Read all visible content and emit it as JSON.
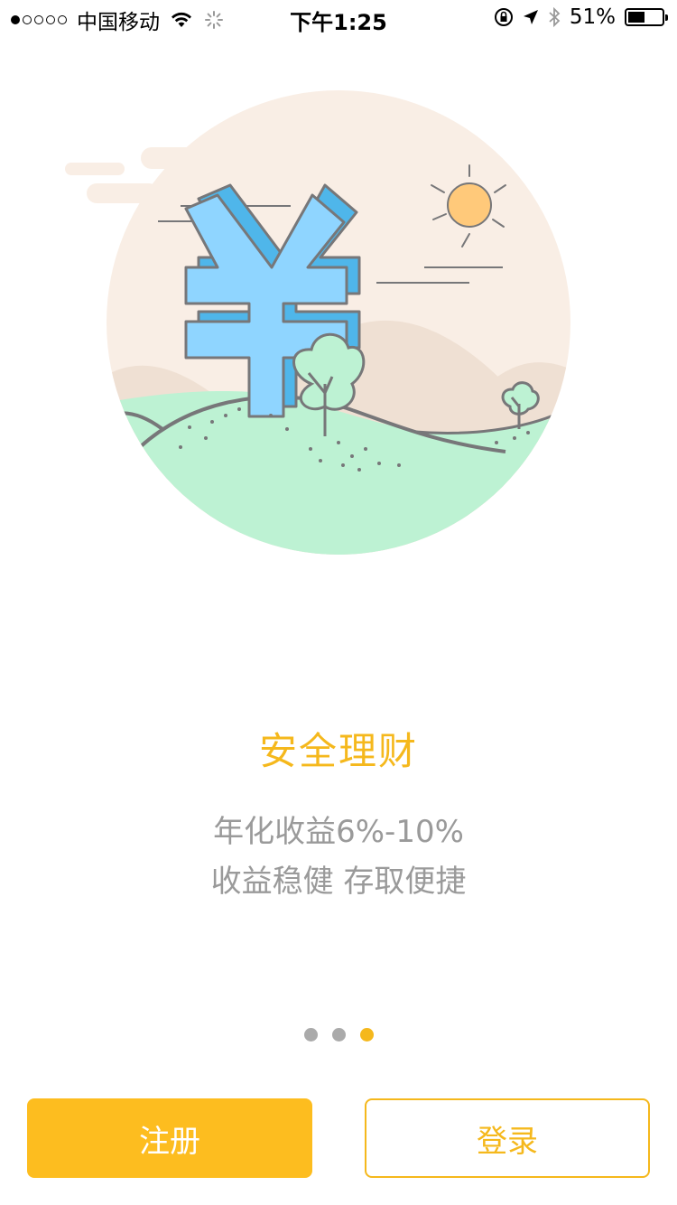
{
  "status_bar": {
    "carrier": "中国移动",
    "time": "下午1:25",
    "battery_text": "51%",
    "battery_level": 0.51,
    "signal_strength": 1,
    "icons": [
      "wifi-icon",
      "loading-icon",
      "orientation-lock-icon",
      "location-arrow-icon",
      "bluetooth-icon",
      "battery-icon"
    ]
  },
  "illustration": {
    "icon": "yuan-hill-illustration-icon",
    "colors": {
      "background_circle": "#f9eee5",
      "yuan": "#8fd5ff",
      "hill": "#bdf2d3",
      "sun": "#ffc97a",
      "outline": "#777779"
    }
  },
  "onboarding": {
    "title": "安全理财",
    "subtitle_line1": "年化收益6%-10%",
    "subtitle_line2": "收益稳健 存取便捷",
    "page_count": 3,
    "active_page": 3
  },
  "actions": {
    "register_label": "注册",
    "login_label": "登录"
  },
  "theme": {
    "accent": "#f5b81c",
    "button_fill": "#fdbd1f",
    "text_gray": "#9a9a9a",
    "dot_inactive": "#aaaaaa"
  }
}
